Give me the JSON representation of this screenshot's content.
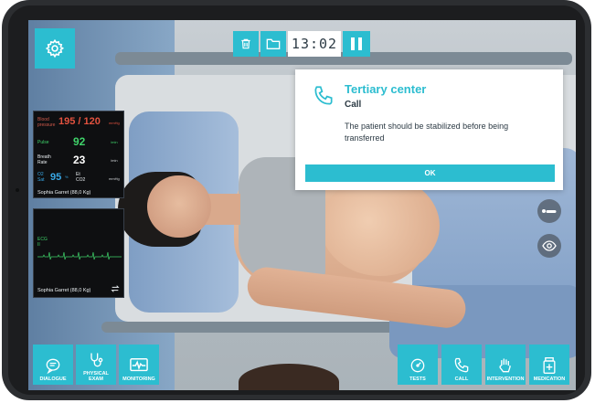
{
  "toolbar": {
    "settings_icon": "gear-icon",
    "delete_icon": "trash-icon",
    "folder_icon": "folder-icon",
    "timer": "13:02",
    "pause_icon": "pause-icon"
  },
  "vitals_monitor": {
    "bp_label_1": "Blood",
    "bp_label_2": "pressure",
    "bp_value": "195 / 120",
    "bp_unit": "mmHg",
    "pulse_label": "Pulse",
    "pulse_value": "92",
    "pulse_unit": "/min",
    "breath_label_1": "Breath",
    "breath_label_2": "Rate",
    "breath_value": "23",
    "breath_unit": "/min",
    "o2_label_1": "O2",
    "o2_label_2": "Sat",
    "o2_value": "95",
    "o2_unit": "%",
    "etco2_label_1": "Et",
    "etco2_label_2": "CO2",
    "etco2_unit": "mmHg",
    "patient": "Sophia Garret (88,0 Kg)"
  },
  "ecg_monitor": {
    "label_1": "ECG",
    "label_2": "II",
    "patient": "Sophia Garret (88,0 Kg)"
  },
  "dialog": {
    "title": "Tertiary center",
    "subtitle": "Call",
    "message": "The patient should be stabilized before being transferred",
    "ok_label": "OK",
    "icon": "phone-icon"
  },
  "side_buttons": {
    "patient_icon": "patient-lying-icon",
    "view_icon": "eye-icon"
  },
  "bottom_left": [
    {
      "label": "DIALOGUE",
      "icon": "chat-icon"
    },
    {
      "label": "PHYSICAL EXAM",
      "icon": "stethoscope-icon"
    },
    {
      "label": "MONITORING",
      "icon": "monitor-icon"
    }
  ],
  "bottom_right": [
    {
      "label": "TESTS",
      "icon": "gauge-icon"
    },
    {
      "label": "CALL",
      "icon": "phone-icon"
    },
    {
      "label": "INTERVENTION",
      "icon": "hand-icon"
    },
    {
      "label": "MEDICATION",
      "icon": "medication-icon"
    }
  ],
  "colors": {
    "accent": "#2cbdd0",
    "bp": "#e3523f",
    "pulse": "#3fd36a",
    "o2": "#38a8e6"
  }
}
